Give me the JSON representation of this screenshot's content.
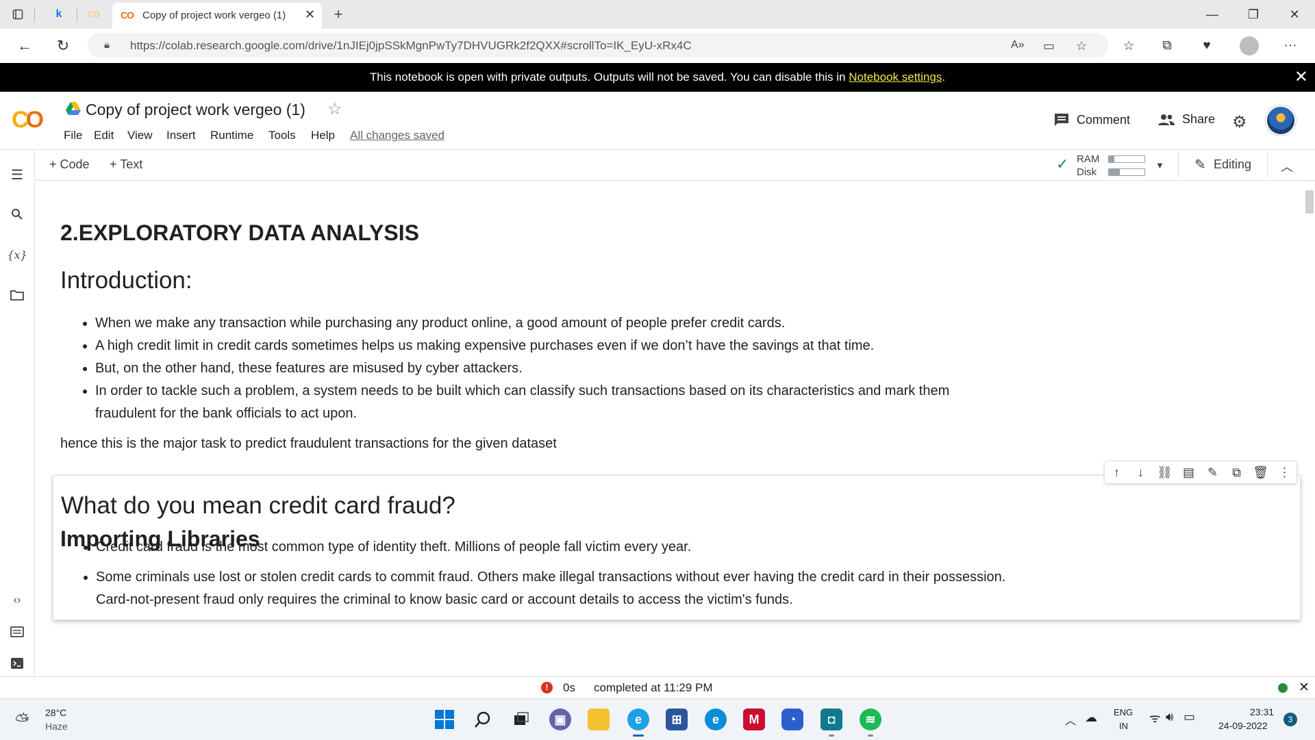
{
  "browser": {
    "tabs": [
      {
        "label": "Copy of project work vergeo (1)",
        "active": true
      }
    ],
    "url": "https://colab.research.google.com/drive/1nJIEj0jpSSkMgnPwTy7DHVUGRk2f2QXX#scrollTo=IK_EyU-xRx4C"
  },
  "banner": {
    "text": "This notebook is open with private outputs. Outputs will not be saved. You can disable this in ",
    "link": "Notebook settings",
    "suffix": "."
  },
  "colab": {
    "title": "Copy of project work vergeo (1)",
    "menu": [
      "File",
      "Edit",
      "View",
      "Insert",
      "Runtime",
      "Tools",
      "Help"
    ],
    "save_status": "All changes saved",
    "comment_label": "Comment",
    "share_label": "Share"
  },
  "toolbar": {
    "code_label": "+ Code",
    "text_label": "+ Text",
    "ram_label": "RAM",
    "disk_label": "Disk",
    "ram_level": 0.15,
    "disk_level": 0.3,
    "editing_label": "Editing"
  },
  "notebook": {
    "section_title": "2.EXPLORATORY DATA ANALYSIS",
    "intro_heading": "Introduction:",
    "intro_bullets": [
      "When we make any transaction while purchasing any product online, a good amount of people prefer credit cards.",
      "A high credit limit in credit cards sometimes helps us making expensive purchases even if we don’t have the savings at that time.",
      "But, on the other hand, these features are misused by cyber attackers.",
      "In order to tackle such a problem, a system needs to be built which can classify such transactions based on its characteristics and mark them fraudulent for the bank officials to act upon."
    ],
    "intro_conclusion": "hence this is the major task to predict fraudulent transactions for the given dataset",
    "fraud_heading": "What do you mean credit card fraud?",
    "fraud_bullets": [
      "Credit card fraud is the most common type of identity theft. Millions of people fall victim every year.",
      "Some criminals use lost or stolen credit cards to commit fraud. Others make illegal transactions without ever having the credit card in their possession. Card-not-present fraud only requires the criminal to know basic card or account details to access the victim's funds."
    ],
    "next_heading": "Importing Libraries"
  },
  "statusbar": {
    "duration": "0s",
    "completed": "completed at 11:29 PM"
  },
  "taskbar": {
    "weather_temp": "28°C",
    "weather_desc": "Haze",
    "lang_top": "ENG",
    "lang_bottom": "IN",
    "time": "23:31",
    "date": "24-09-2022",
    "notification_count": "3"
  },
  "colors": {
    "banner_link": "#f4e94d",
    "colab_orange": "#e8710a",
    "colab_yellow": "#f9ab00",
    "status_error": "#d93025",
    "status_ok": "#1e8e3e"
  }
}
